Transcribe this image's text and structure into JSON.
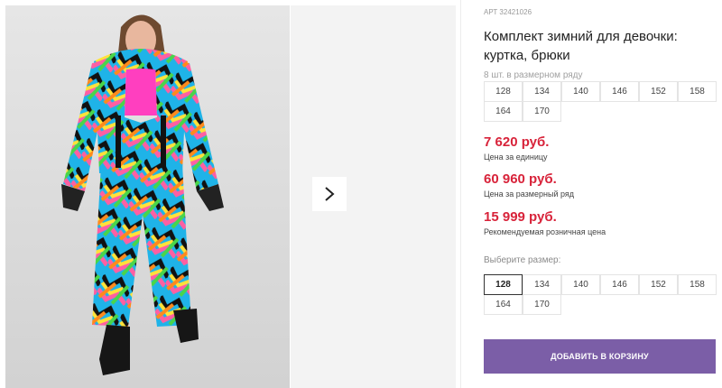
{
  "gallery": {
    "next_icon": "chevron-right-icon",
    "image_alt": "Girl wearing colorful winter jacket and pants set"
  },
  "product": {
    "sku": "АРТ 32421026",
    "title": "Комплект зимний для девочки: куртка, брюки",
    "pack_note": "8 шт. в размерном ряду",
    "pack_sizes": [
      "128",
      "134",
      "140",
      "146",
      "152",
      "158",
      "164",
      "170"
    ]
  },
  "prices": {
    "unit_price": "7 620 руб.",
    "unit_label": "Цена за единицу",
    "pack_price": "60 960 руб.",
    "pack_label": "Цена за размерный ряд",
    "retail_price": "15 999 руб.",
    "retail_label": "Рекомендуемая розничная цена"
  },
  "size_select": {
    "label": "Выберите размер:",
    "sizes": [
      "128",
      "134",
      "140",
      "146",
      "152",
      "158",
      "164",
      "170"
    ],
    "selected": "128"
  },
  "actions": {
    "add_to_cart": "ДОБАВИТЬ В КОРЗИНУ"
  },
  "colors": {
    "price": "#d8233a",
    "button": "#7b5ea7"
  }
}
